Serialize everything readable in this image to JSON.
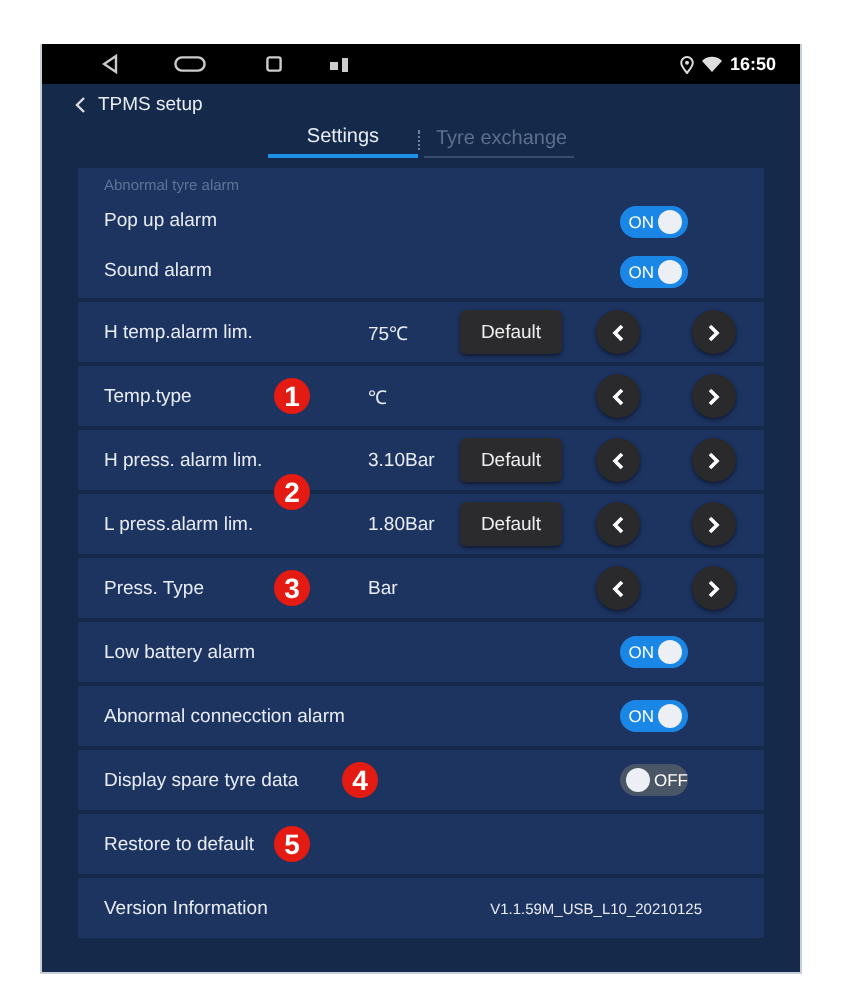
{
  "status_bar": {
    "time": "16:50"
  },
  "header": {
    "title": "TPMS setup"
  },
  "tabs": [
    {
      "label": "Settings",
      "selected": true
    },
    {
      "label": "Tyre exchange",
      "selected": false
    }
  ],
  "section": {
    "title": "Abnormal tyre alarm",
    "rows": [
      {
        "kind": "toggle",
        "label": "Pop up alarm",
        "on": true,
        "state_label": "ON"
      },
      {
        "kind": "toggle",
        "label": "Sound alarm",
        "on": true,
        "state_label": "ON"
      }
    ]
  },
  "rows": [
    {
      "kind": "stepper",
      "label": "H temp.alarm lim.",
      "value": "75℃",
      "default_button": "Default"
    },
    {
      "kind": "stepper",
      "label": "Temp.type",
      "value": "℃",
      "marker": "1"
    },
    {
      "kind": "stepper",
      "label": "H press. alarm lim.",
      "value": "3.10Bar",
      "default_button": "Default",
      "marker": "2"
    },
    {
      "kind": "stepper",
      "label": "L press.alarm lim.",
      "value": "1.80Bar",
      "default_button": "Default"
    },
    {
      "kind": "stepper",
      "label": "Press. Type",
      "value": "Bar",
      "marker": "3"
    },
    {
      "kind": "toggle",
      "label": "Low battery alarm",
      "on": true,
      "state_label": "ON"
    },
    {
      "kind": "toggle",
      "label": "Abnormal connecction alarm",
      "on": true,
      "state_label": "ON"
    },
    {
      "kind": "toggle",
      "label": "Display spare tyre data",
      "on": false,
      "state_label": "OFF",
      "marker": "4"
    },
    {
      "kind": "action",
      "label": "Restore to default",
      "marker": "5"
    },
    {
      "kind": "info",
      "label": "Version Information",
      "value": "V1.1.59M_USB_L10_20210125"
    }
  ]
}
